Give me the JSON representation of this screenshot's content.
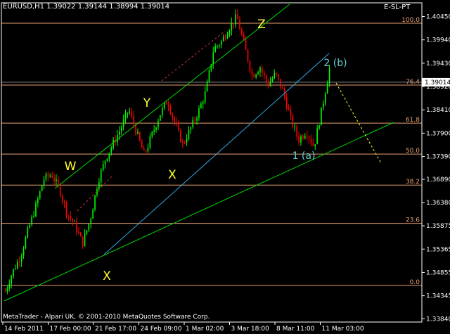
{
  "header": {
    "title": "EURUSD,H1  1.39022 1.39144 1.38994 1.39014",
    "indicator": "E-SL-PT"
  },
  "footer": {
    "copyright": "MetaTrader - Alpari UK, © 2001-2010 MetaQuotes Software Corp."
  },
  "current_price": "1.39014",
  "colors": {
    "background": "#000000",
    "bull": "#00ff00",
    "bear": "#ff0000",
    "fib": "#e8a070",
    "channel": "#00d800",
    "channel_blue": "#33aaee",
    "wave_yellow": "#ffff33",
    "wave_teal": "#66cccc",
    "axis_text": "#ffffff"
  },
  "chart_data": {
    "type": "candlestick",
    "symbol": "EURUSD",
    "timeframe": "H1",
    "y_ticks": [
      "1.40450",
      "1.39940",
      "1.39430",
      "1.38920",
      "1.38410",
      "1.37900",
      "1.37390",
      "1.36890",
      "1.36380",
      "1.35875",
      "1.35365",
      "1.34855",
      "1.34345",
      "1.33840"
    ],
    "ylim": [
      1.3377,
      1.4075
    ],
    "x_ticks": [
      "14 Feb 2011",
      "17 Feb 00:00",
      "21 Feb 17:00",
      "24 Feb 09:00",
      "1 Mar 02:00",
      "3 Mar 18:00",
      "8 Mar 11:00",
      "11 Mar 03:00"
    ],
    "fib_levels": [
      {
        "label": "100.0",
        "price": 1.40305
      },
      {
        "label": "76.4",
        "price": 1.38951
      },
      {
        "label": "61.8",
        "price": 1.3812
      },
      {
        "label": "50.0",
        "price": 1.37443
      },
      {
        "label": "38.2",
        "price": 1.36765
      },
      {
        "label": "23.6",
        "price": 1.35928
      },
      {
        "label": "0.0",
        "price": 1.34572
      }
    ],
    "wave_labels": [
      {
        "text": "W",
        "color": "yellow"
      },
      {
        "text": "Y",
        "color": "yellow"
      },
      {
        "text": "X",
        "color": "yellow"
      },
      {
        "text": "Z",
        "color": "yellow"
      },
      {
        "text": "X",
        "color": "yellow"
      },
      {
        "text": "2 (b)",
        "color": "teal"
      },
      {
        "text": "1 (a)",
        "color": "teal"
      }
    ],
    "price_path": [
      1.3444,
      1.3488,
      1.3522,
      1.358,
      1.3632,
      1.369,
      1.37,
      1.3668,
      1.3615,
      1.359,
      1.3549,
      1.36,
      1.3684,
      1.3735,
      1.3768,
      1.3802,
      1.3842,
      1.3792,
      1.3742,
      1.3786,
      1.383,
      1.3862,
      1.381,
      1.3765,
      1.38,
      1.3836,
      1.3882,
      1.3975,
      1.399,
      1.402,
      1.4045,
      1.398,
      1.3915,
      1.3935,
      1.3895,
      1.392,
      1.388,
      1.382,
      1.3775,
      1.3795,
      1.376,
      1.3842,
      1.393
    ]
  }
}
